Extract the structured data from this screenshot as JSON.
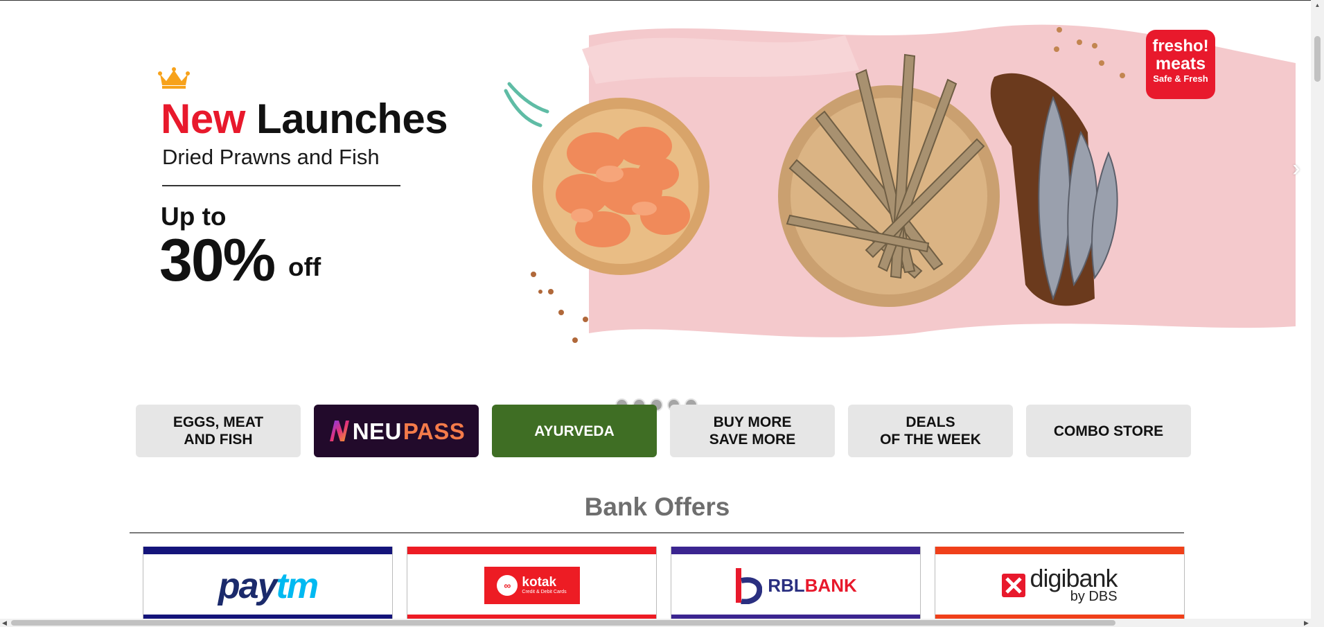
{
  "hero": {
    "title_red": "New",
    "title_dark": "Launches",
    "subtitle": "Dried Prawns and Fish",
    "upto": "Up to",
    "percent": "30%",
    "off": "off",
    "brand_line1": "fresho!",
    "brand_line2": "meats",
    "brand_line3": "Safe & Fresh",
    "next_arrow": "›",
    "slide_count": 5
  },
  "tiles": [
    {
      "label": "EGGS, MEAT\nAND FISH"
    },
    {
      "neu": "NEU",
      "pass": "PASS"
    },
    {
      "label": "AYURVEDA"
    },
    {
      "label": "BUY MORE\nSAVE MORE"
    },
    {
      "label": "DEALS\nOF THE WEEK"
    },
    {
      "label": "COMBO STORE"
    }
  ],
  "bank_offers": {
    "title": "Bank Offers",
    "paytm": {
      "pay": "pay",
      "tm": "tm"
    },
    "kotak": {
      "name": "kotak",
      "sub": "Credit & Debit Cards"
    },
    "rbl": {
      "part1": "RBL",
      "part2": "BANK"
    },
    "digibank": {
      "name": "digibank",
      "sub": "by DBS"
    }
  },
  "colors": {
    "accent_red": "#e8192c",
    "neupass_bg": "#220a2b",
    "ayurveda_bg": "#3f6e24",
    "tile_bg": "#e6e6e6",
    "paytm_bar": "#14147a",
    "kotak_bar": "#ed1c24",
    "rbl_bar": "#3b2590",
    "dbs_bar": "#f0401a"
  }
}
